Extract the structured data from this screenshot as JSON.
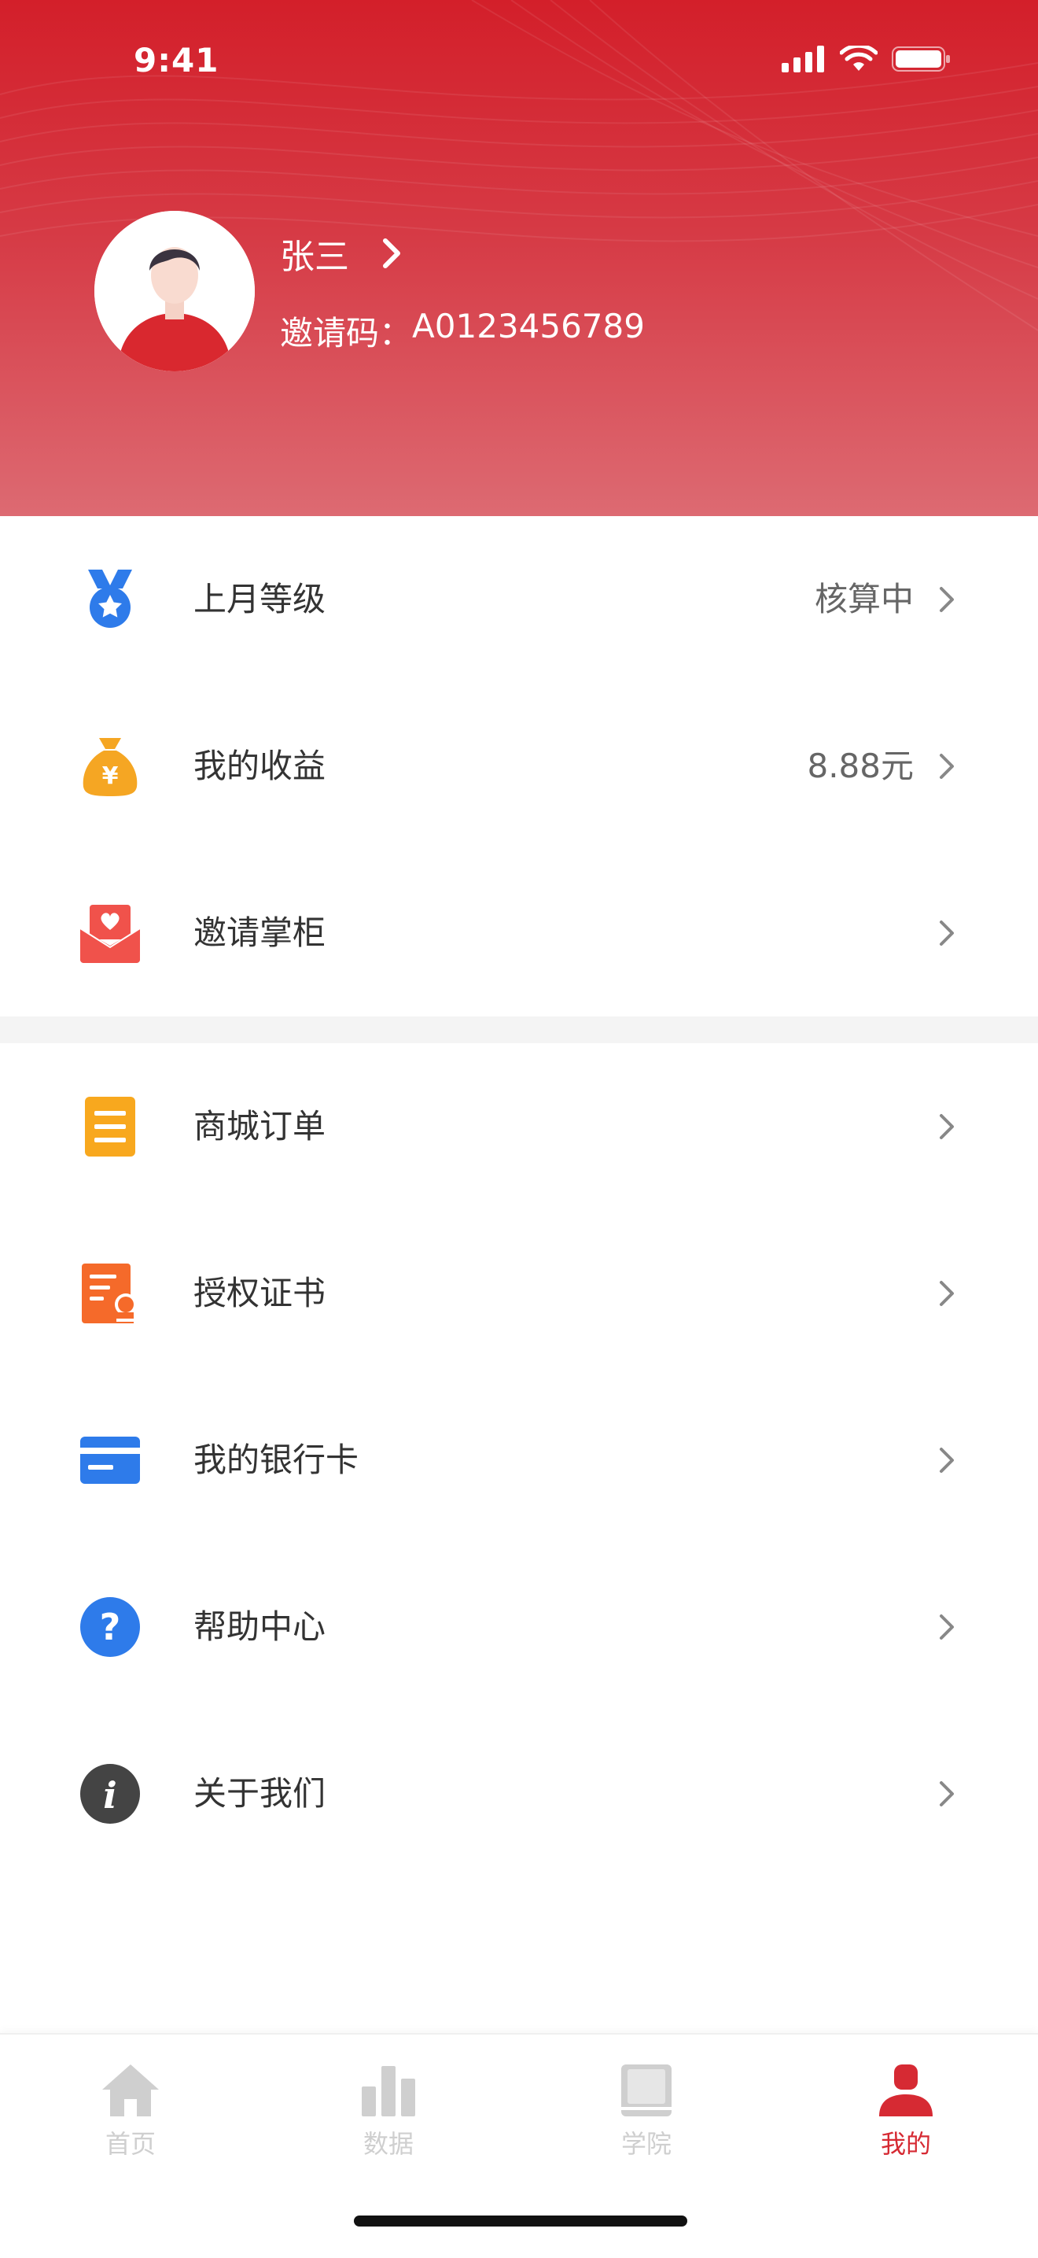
{
  "status_bar": {
    "time": "9:41"
  },
  "profile": {
    "name": "张三",
    "invite_label": "邀请码：",
    "invite_code": "A0123456789"
  },
  "menu_group_1": [
    {
      "label": "上月等级",
      "value": "核算中",
      "icon": "medal-star-icon",
      "icon_color": "#2e7bea"
    },
    {
      "label": "我的收益",
      "value": "8.88元",
      "icon": "money-bag-icon",
      "icon_color": "#f5a623"
    },
    {
      "label": "邀请掌柜",
      "value": "",
      "icon": "invitation-envelope-icon",
      "icon_color": "#f0524b"
    }
  ],
  "menu_group_2": [
    {
      "label": "商城订单",
      "icon": "order-list-icon",
      "icon_color": "#f8a81e"
    },
    {
      "label": "授权证书",
      "icon": "certificate-icon",
      "icon_color": "#f56a2a"
    },
    {
      "label": "我的银行卡",
      "icon": "bank-card-icon",
      "icon_color": "#2e7bea"
    },
    {
      "label": "帮助中心",
      "icon": "help-question-icon",
      "icon_color": "#2e7bea"
    },
    {
      "label": "关于我们",
      "icon": "info-icon",
      "icon_color": "#444444"
    }
  ],
  "tabbar": {
    "tabs": [
      {
        "label": "首页",
        "icon": "home-icon"
      },
      {
        "label": "数据",
        "icon": "bar-chart-icon"
      },
      {
        "label": "学院",
        "icon": "book-icon"
      },
      {
        "label": "我的",
        "icon": "person-icon"
      }
    ],
    "active_index": 3,
    "active_color": "#d62a33",
    "inactive_color": "#cfcfcf"
  },
  "colors": {
    "header_top": "#d31f2a",
    "header_bottom": "#dd6a72"
  }
}
